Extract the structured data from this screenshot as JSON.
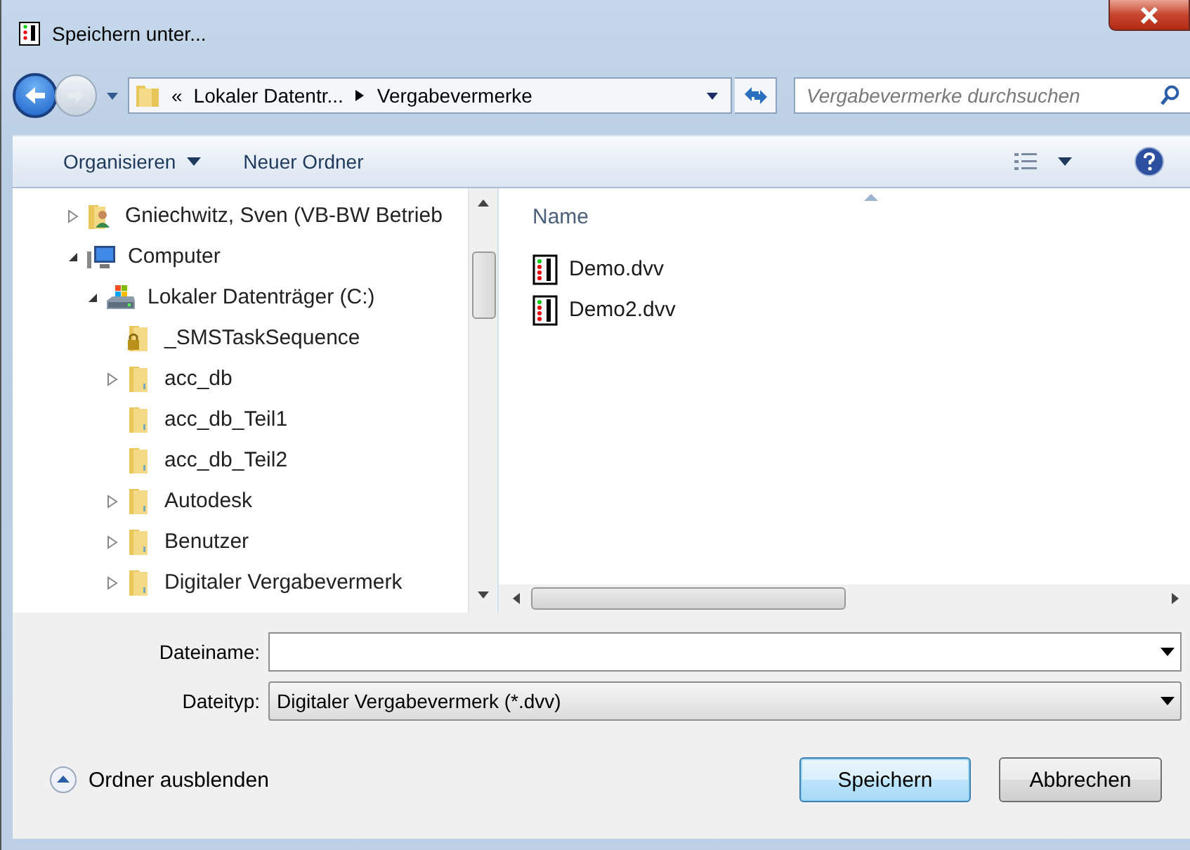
{
  "window": {
    "title": "Speichern unter..."
  },
  "address": {
    "overflow": "«",
    "path": [
      "Lokaler Datentr...",
      "Vergabevermerke"
    ]
  },
  "search": {
    "placeholder": "Vergabevermerke durchsuchen"
  },
  "toolbar": {
    "buttons": [
      {
        "label": "Organisieren",
        "dropdown": true
      },
      {
        "label": "Neuer Ordner",
        "dropdown": false
      }
    ]
  },
  "tree": [
    {
      "label": "Gniechwitz, Sven (VB-BW Betrieb",
      "kind": "user",
      "has_children": true,
      "expanded": false
    },
    {
      "label": "Computer",
      "kind": "computer",
      "has_children": true,
      "expanded": true,
      "children": [
        {
          "label": "Lokaler Datenträger (C:)",
          "kind": "drive",
          "has_children": true,
          "expanded": true,
          "children": [
            {
              "label": "_SMSTaskSequence",
              "kind": "locked-folder",
              "has_children": false
            },
            {
              "label": "acc_db",
              "kind": "folder",
              "has_children": true,
              "expanded": false
            },
            {
              "label": "acc_db_Teil1",
              "kind": "folder",
              "has_children": false
            },
            {
              "label": "acc_db_Teil2",
              "kind": "folder",
              "has_children": false
            },
            {
              "label": "Autodesk",
              "kind": "folder",
              "has_children": true,
              "expanded": false
            },
            {
              "label": "Benutzer",
              "kind": "folder",
              "has_children": true,
              "expanded": false
            },
            {
              "label": "Digitaler Vergabevermerk",
              "kind": "folder",
              "has_children": true,
              "expanded": false
            }
          ]
        }
      ]
    }
  ],
  "files": {
    "column": "Name",
    "items": [
      "Demo.dvv",
      "Demo2.dvv"
    ]
  },
  "filename": {
    "label": "Dateiname:"
  },
  "filetype": {
    "label": "Dateityp:",
    "value": "Digitaler Vergabevermerk (*.dvv)"
  },
  "hide_folders": "Ordner ausblenden",
  "buttons": [
    {
      "label": "Speichern",
      "default": true
    },
    {
      "label": "Abbrechen",
      "default": false
    }
  ]
}
